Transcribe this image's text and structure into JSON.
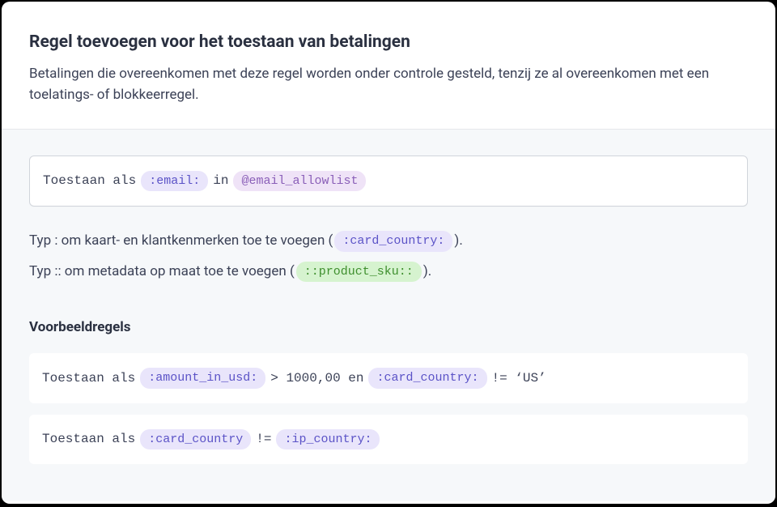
{
  "header": {
    "title": "Regel toevoegen voor het toestaan van betalingen",
    "subtitle": "Betalingen die overeenkomen met deze regel worden onder controle gesteld, tenzij ze al overeenkomen met een toelatings- of blokkeerregel."
  },
  "rule_input": {
    "prefix": "Toestaan als",
    "token1": ":email:",
    "connector": "in",
    "token2": "@email_allowlist"
  },
  "hints": {
    "line1_before": "Typ : om kaart- en klantkenmerken toe te voegen ( ",
    "line1_pill": ":card_country:",
    "line1_after": " ).",
    "line2_before": "Typ :: om metadata op maat toe te voegen ( ",
    "line2_pill": "::product_sku::",
    "line2_after": " )."
  },
  "examples": {
    "heading": "Voorbeeldregels",
    "ex1": {
      "prefix": "Toestaan als",
      "t1": ":amount_in_usd:",
      "mid1": "> 1000,00 en",
      "t2": ":card_country:",
      "mid2": "!= ‘US’"
    },
    "ex2": {
      "prefix": "Toestaan als",
      "t1": ":card_country",
      "mid1": "!=",
      "t2": ":ip_country:"
    }
  }
}
